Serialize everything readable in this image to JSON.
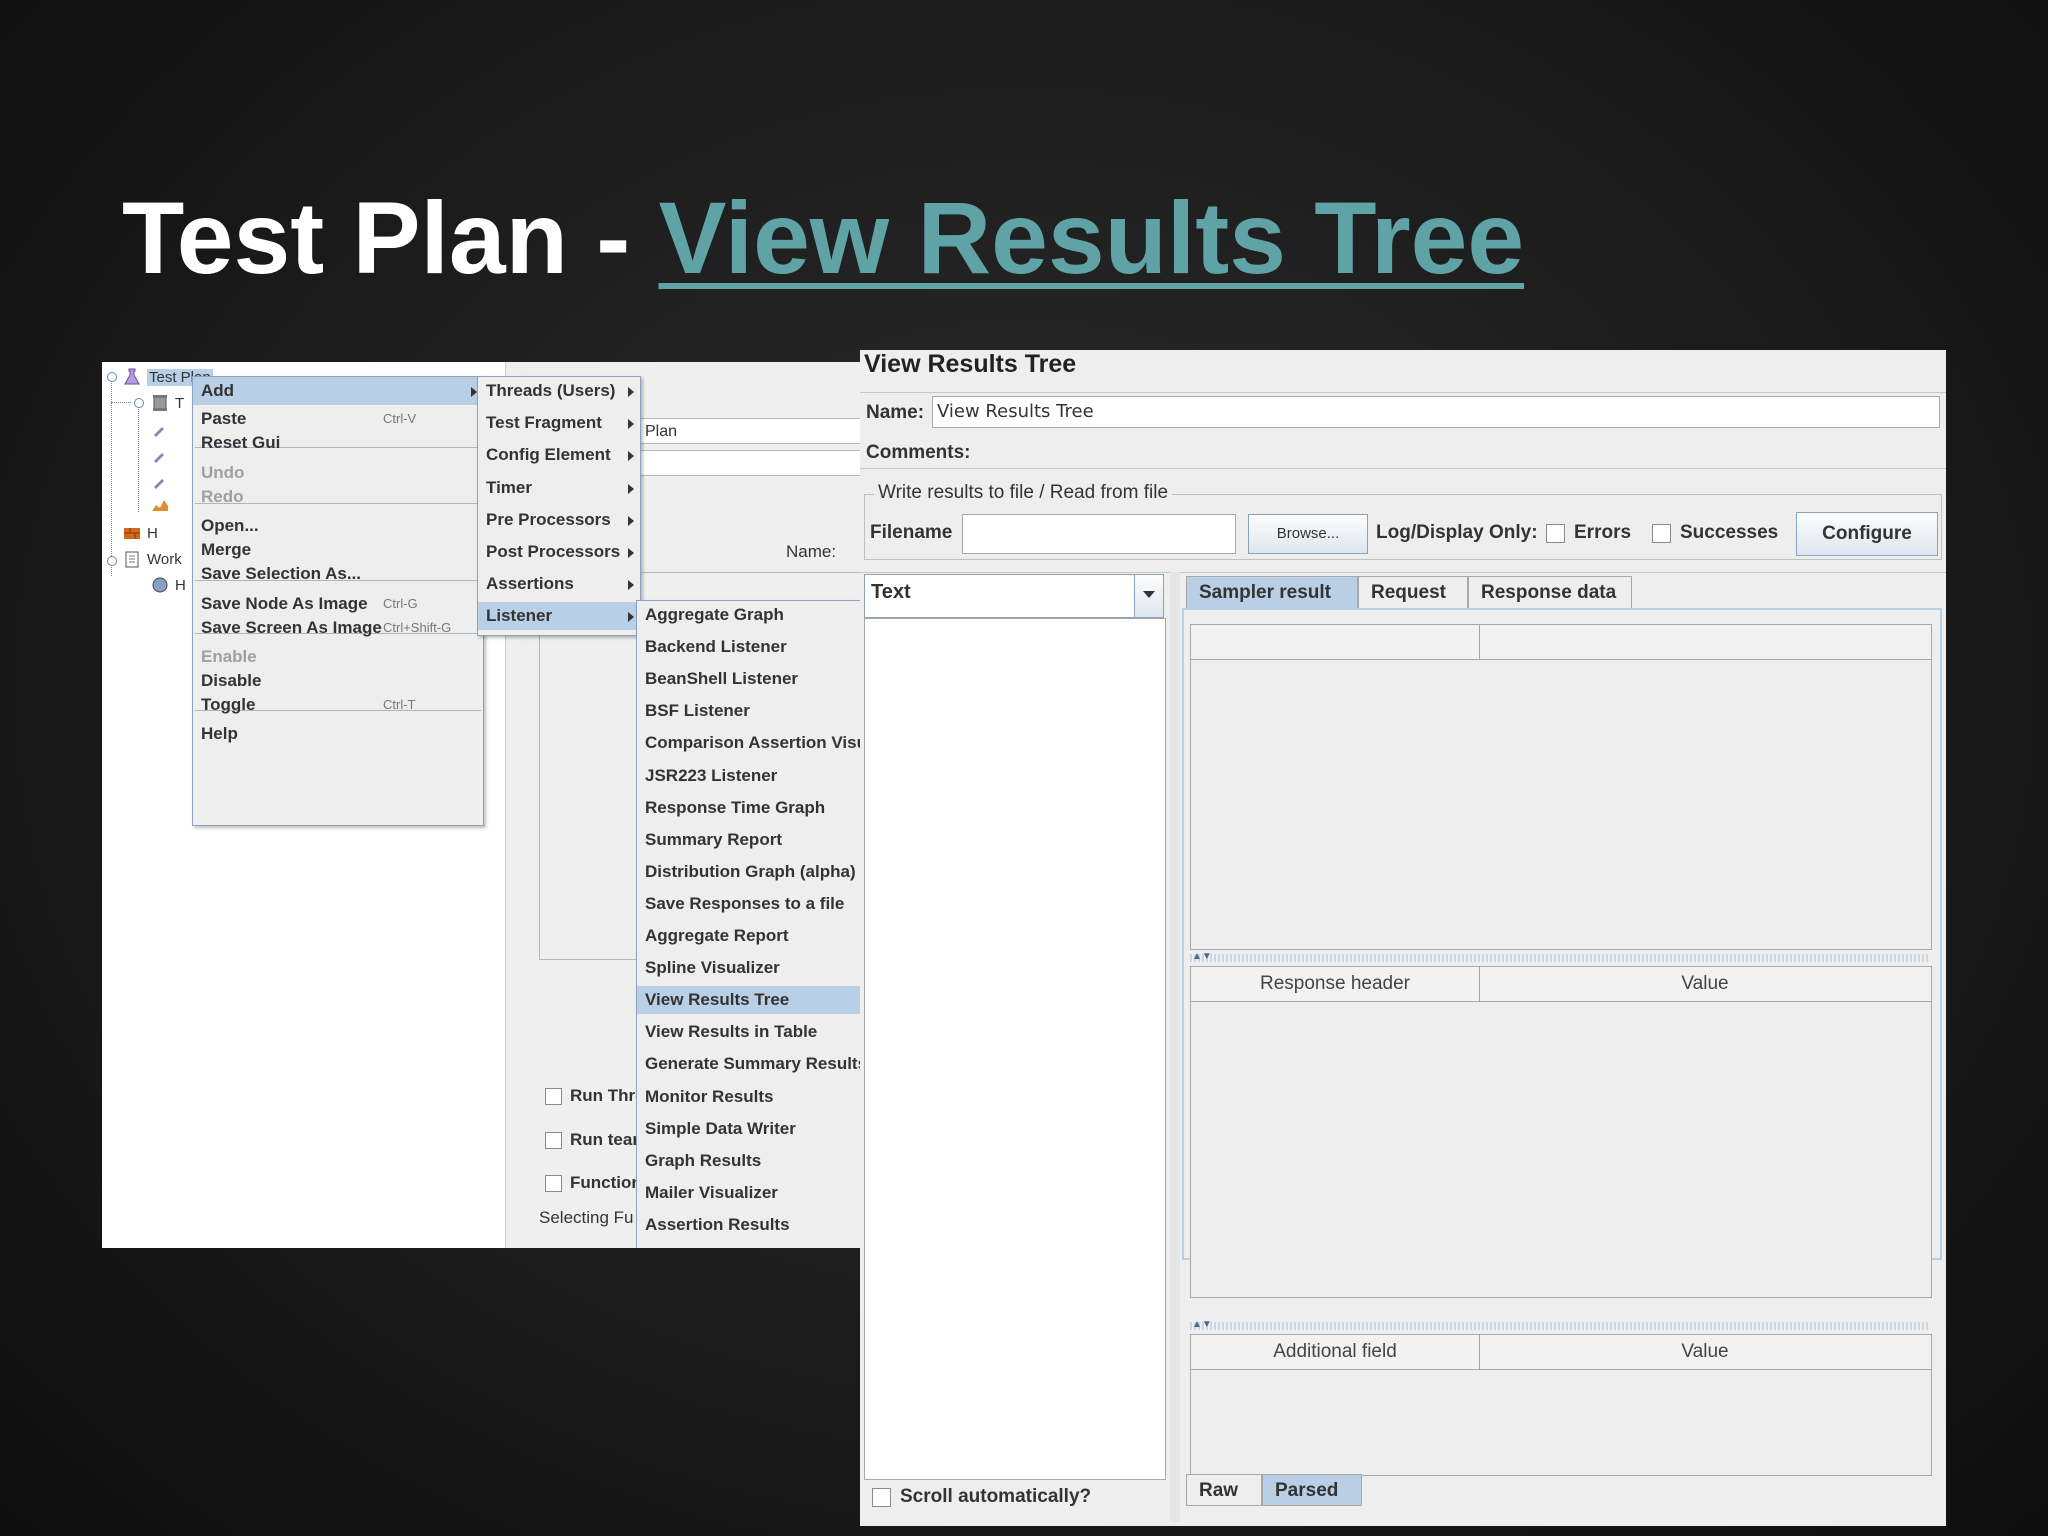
{
  "slide": {
    "title_prefix": "Test Plan - ",
    "title_link": "View Results Tree"
  },
  "tree": {
    "items": [
      "Test Plan",
      "T",
      "H",
      "Work",
      "H"
    ]
  },
  "context_menu": {
    "items": [
      {
        "label": "Add",
        "shortcut": "",
        "submenu": true,
        "highlighted": true,
        "disabled": false
      },
      {
        "label": "Paste",
        "shortcut": "Ctrl-V",
        "disabled": false
      },
      {
        "label": "Reset Gui",
        "shortcut": "",
        "disabled": false
      },
      {
        "label": "Undo",
        "shortcut": "",
        "disabled": true
      },
      {
        "label": "Redo",
        "shortcut": "",
        "disabled": true
      },
      {
        "label": "Open...",
        "shortcut": "",
        "disabled": false
      },
      {
        "label": "Merge",
        "shortcut": "",
        "disabled": false
      },
      {
        "label": "Save Selection As...",
        "shortcut": "",
        "disabled": false
      },
      {
        "label": "Save Node As Image",
        "shortcut": "Ctrl-G",
        "disabled": false
      },
      {
        "label": "Save Screen As Image",
        "shortcut": "Ctrl+Shift-G",
        "disabled": false
      },
      {
        "label": "Enable",
        "shortcut": "",
        "disabled": true
      },
      {
        "label": "Disable",
        "shortcut": "",
        "disabled": false
      },
      {
        "label": "Toggle",
        "shortcut": "Ctrl-T",
        "disabled": false
      },
      {
        "label": "Help",
        "shortcut": "",
        "disabled": false
      }
    ]
  },
  "add_submenu": {
    "items": [
      "Threads (Users)",
      "Test Fragment",
      "Config Element",
      "Timer",
      "Pre Processors",
      "Post Processors",
      "Assertions",
      "Listener"
    ]
  },
  "listener_submenu": {
    "items": [
      "Aggregate Graph",
      "Backend Listener",
      "BeanShell Listener",
      "BSF Listener",
      "Comparison Assertion Visu",
      "JSR223 Listener",
      "Response Time Graph",
      "Summary Report",
      "Distribution Graph (alpha)",
      "Save Responses to a file",
      "Aggregate Report",
      "Spline Visualizer",
      "View Results Tree",
      "View Results in Table",
      "Generate Summary Results",
      "Monitor Results",
      "Simple Data Writer",
      "Graph Results",
      "Mailer Visualizer",
      "Assertion Results"
    ],
    "highlighted": "View Results Tree"
  },
  "props": {
    "name_value": "Plan",
    "name_label": "Name:",
    "checkboxes": [
      "Run Thre",
      "Run tear",
      "Functiona"
    ],
    "selecting": "Selecting Fu"
  },
  "vrt": {
    "title": "View Results Tree",
    "name_label": "Name:",
    "name_value": "View Results Tree",
    "comments_label": "Comments:",
    "file_group_title": "Write results to file / Read from file",
    "filename_label": "Filename",
    "filename_value": "",
    "browse_label": "Browse...",
    "log_display_label": "Log/Display Only:",
    "errors_label": "Errors",
    "successes_label": "Successes",
    "configure_label": "Configure",
    "renderer_value": "Text",
    "tabs": [
      "Sampler result",
      "Request",
      "Response data"
    ],
    "response_header_col": "Response header",
    "value_col": "Value",
    "additional_field_col": "Additional field",
    "value_col2": "Value",
    "bottom_tabs": [
      "Raw",
      "Parsed"
    ],
    "scroll_auto_label": "Scroll automatically?"
  }
}
